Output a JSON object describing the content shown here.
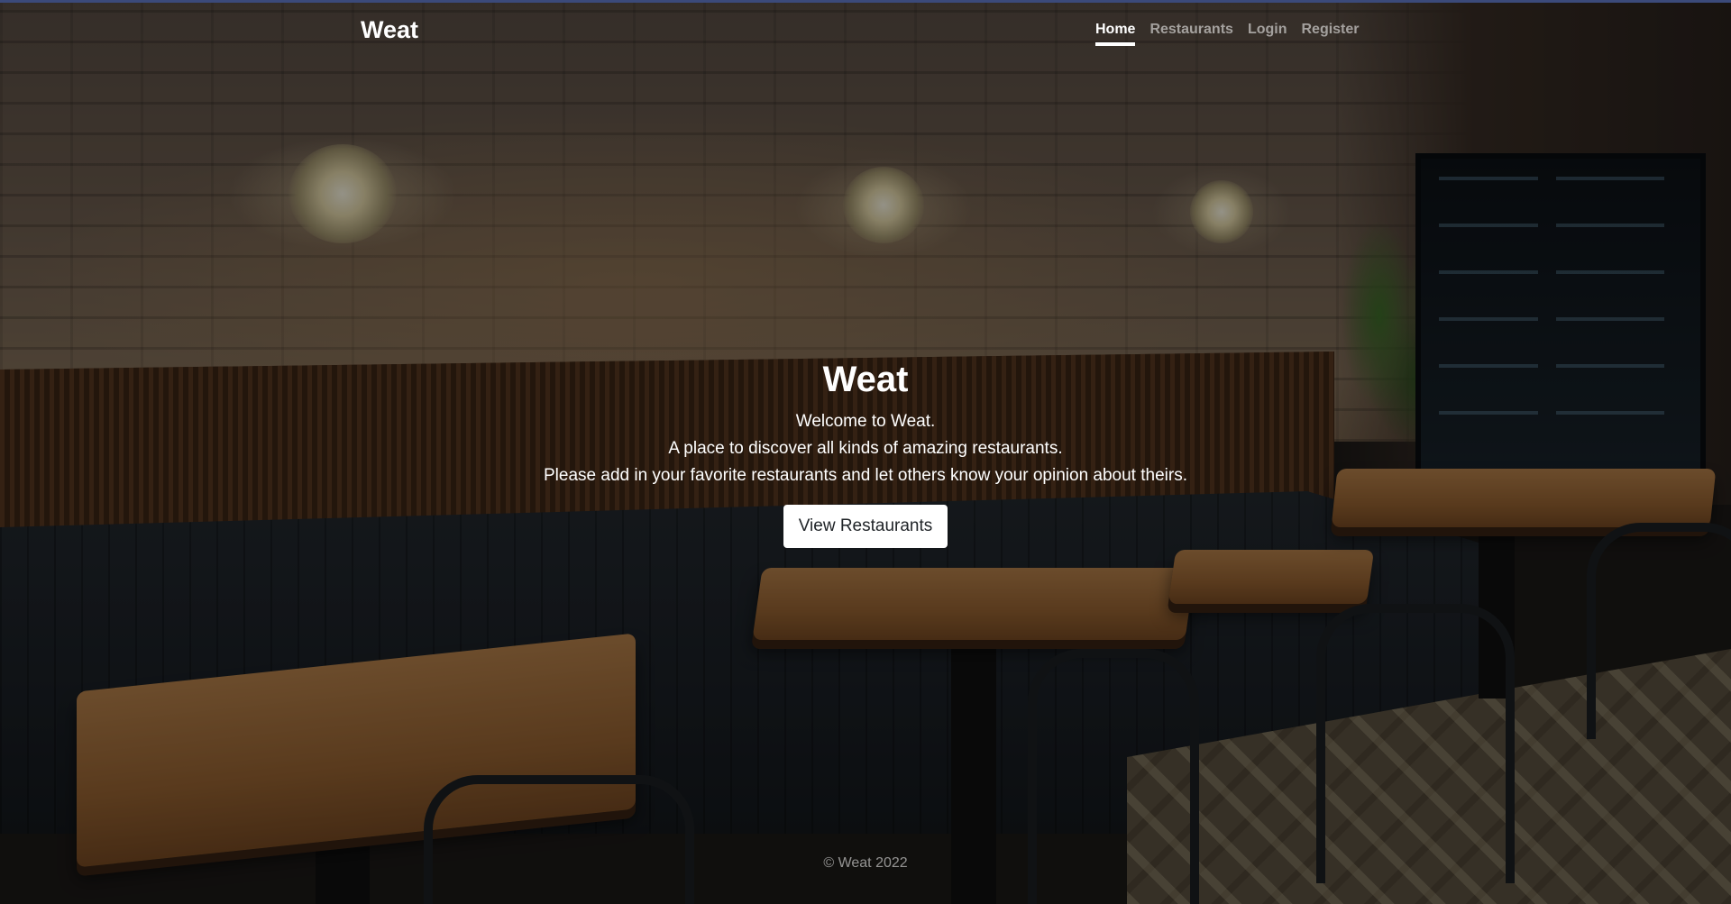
{
  "brand": "Weat",
  "nav": {
    "items": [
      {
        "label": "Home",
        "active": true
      },
      {
        "label": "Restaurants",
        "active": false
      },
      {
        "label": "Login",
        "active": false
      },
      {
        "label": "Register",
        "active": false
      }
    ]
  },
  "hero": {
    "title": "Weat",
    "lines": [
      "Welcome to Weat.",
      "A place to discover all kinds of amazing restaurants.",
      "Please add in your favorite restaurants and let others know your opinion about theirs."
    ],
    "cta_label": "View Restaurants"
  },
  "footer": {
    "text": "© Weat 2022"
  },
  "colors": {
    "accent": "#3b4a7a",
    "text": "#ffffff",
    "muted_text": "rgba(255,255,255,0.55)",
    "button_bg": "#ffffff",
    "button_text": "#212529"
  },
  "background": {
    "description": "restaurant-interior-photo"
  }
}
